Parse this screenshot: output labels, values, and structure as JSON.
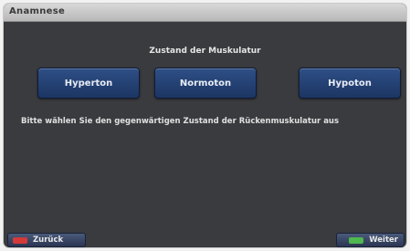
{
  "window": {
    "title": "Anamnese"
  },
  "main": {
    "heading": "Zustand der Muskulatur",
    "options": [
      {
        "label": "Hyperton"
      },
      {
        "label": "Normoton"
      },
      {
        "label": "Hypoton"
      }
    ],
    "instruction": "Bitte wählen Sie den gegenwärtigen Zustand der Rückenmuskulatur aus"
  },
  "footer": {
    "back_label": "Zurück",
    "next_label": "Weiter",
    "back_key_color": "#d33a3a",
    "next_key_color": "#4fb84f"
  }
}
